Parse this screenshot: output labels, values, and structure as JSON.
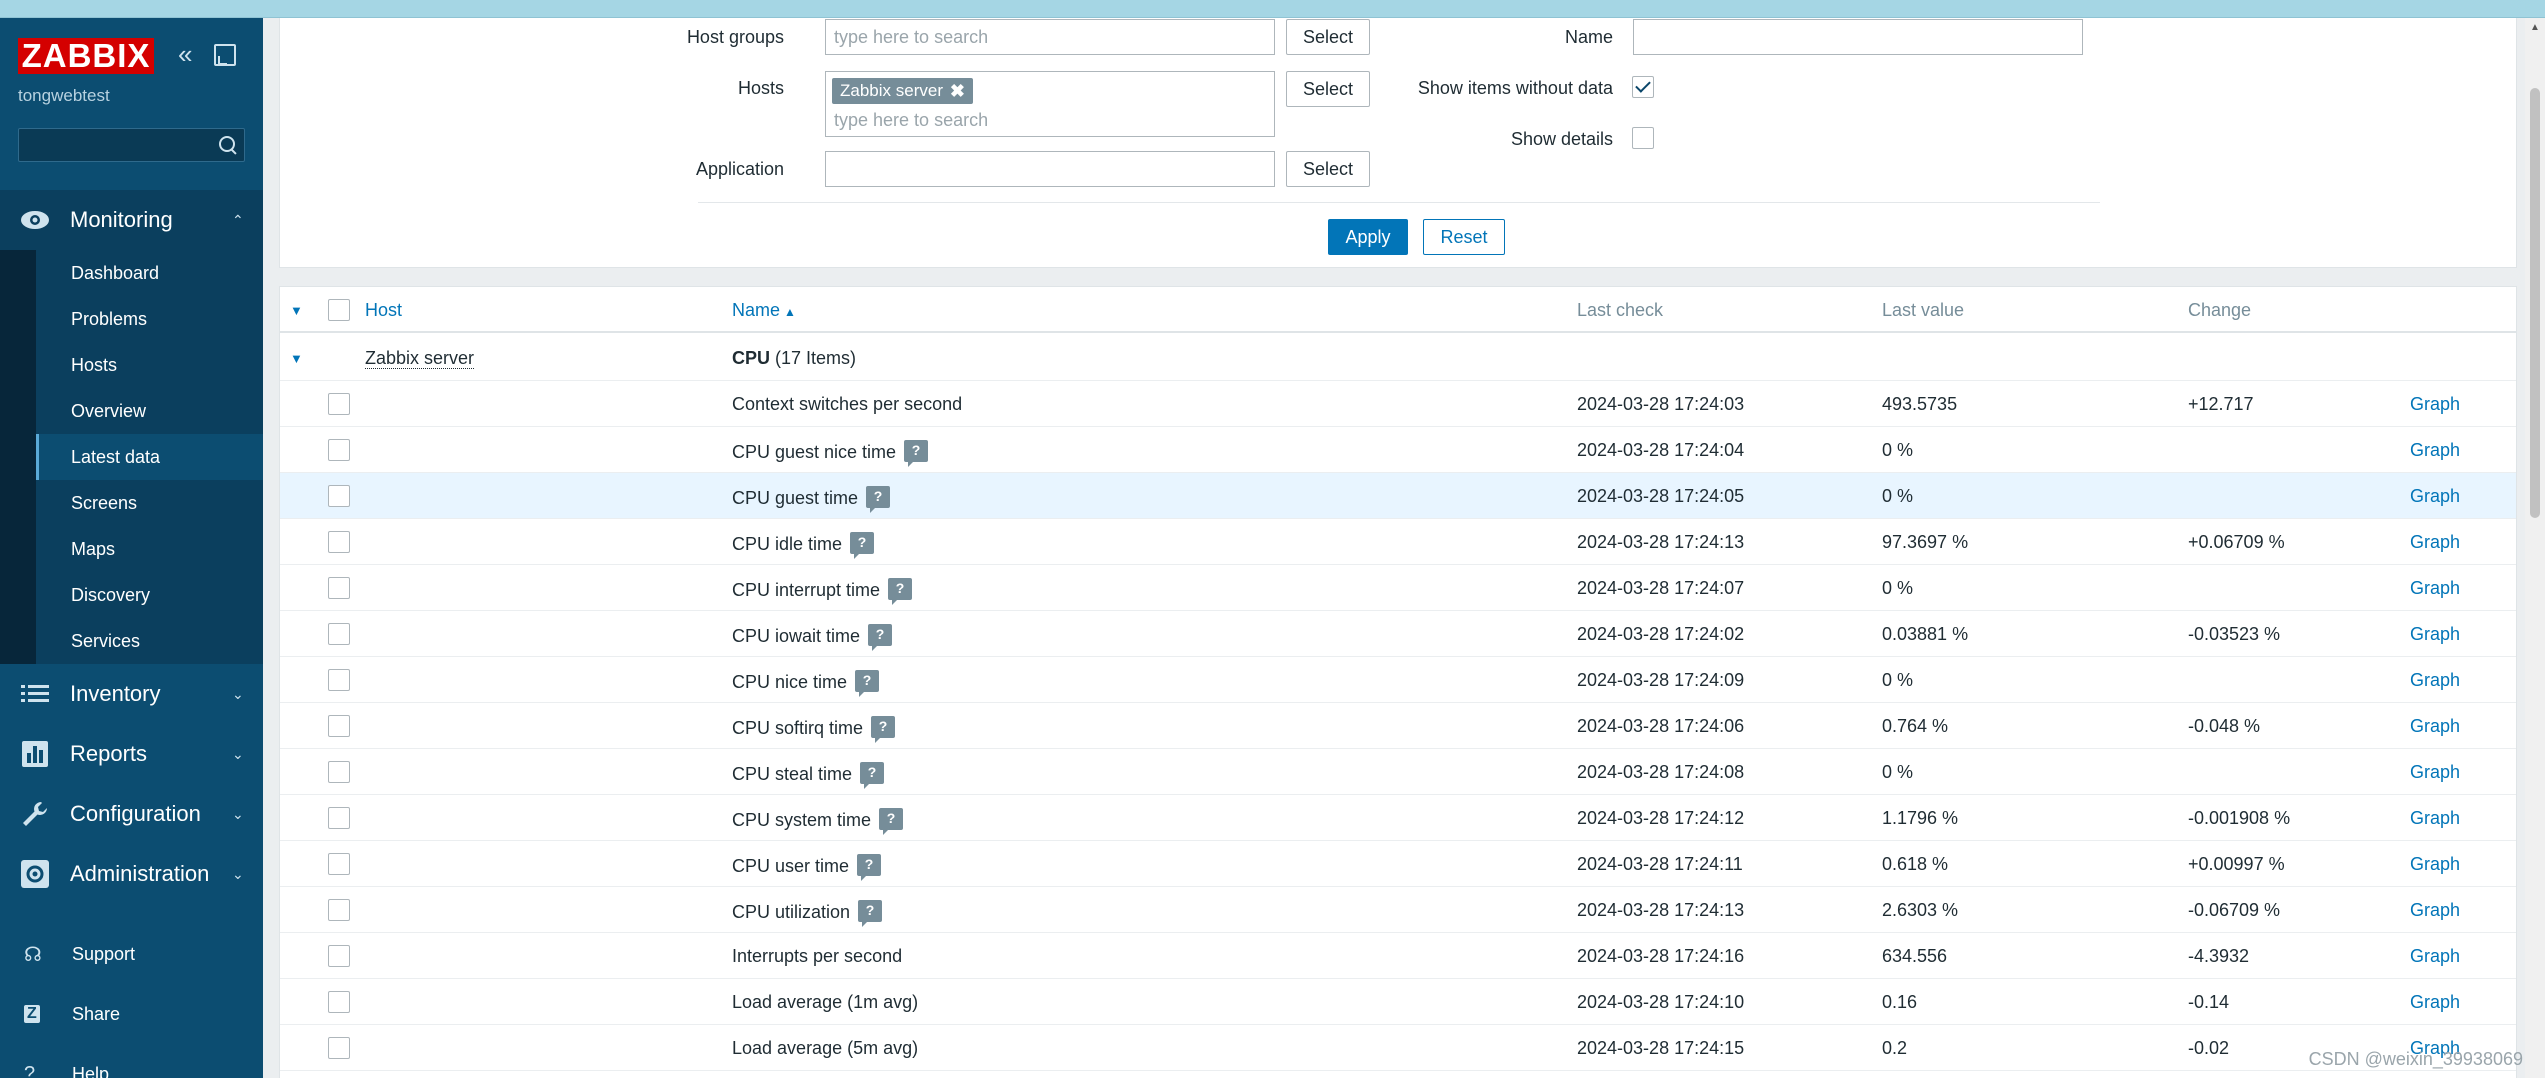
{
  "sidebar": {
    "logo": "ZABBIX",
    "server_name": "tongwebtest",
    "collapse_glyph": "«",
    "sections": [
      {
        "label": "Monitoring",
        "icon": "eye-icon",
        "chevron": "⌃"
      },
      {
        "label": "Inventory",
        "icon": "list-icon",
        "chevron": "⌄"
      },
      {
        "label": "Reports",
        "icon": "bar-chart-icon",
        "chevron": "⌄"
      },
      {
        "label": "Configuration",
        "icon": "wrench-icon",
        "chevron": "⌄"
      },
      {
        "label": "Administration",
        "icon": "gear-icon",
        "chevron": "⌄"
      }
    ],
    "monitoring_items": [
      "Dashboard",
      "Problems",
      "Hosts",
      "Overview",
      "Latest data",
      "Screens",
      "Maps",
      "Discovery",
      "Services"
    ],
    "footer": [
      {
        "label": "Support",
        "icon": "headset-icon",
        "glyph": "☊"
      },
      {
        "label": "Share",
        "icon": "share-icon",
        "glyph": "Z"
      },
      {
        "label": "Help",
        "icon": "help-icon",
        "glyph": "?"
      }
    ]
  },
  "filter": {
    "host_groups_label": "Host groups",
    "host_groups_placeholder": "type here to search",
    "hosts_label": "Hosts",
    "hosts_chip": "Zabbix server",
    "hosts_chip_remove": "✖",
    "hosts_placeholder": "type here to search",
    "application_label": "Application",
    "select_label": "Select",
    "name_label": "Name",
    "show_items_without_data_label": "Show items without data",
    "show_items_without_data": true,
    "show_details_label": "Show details",
    "show_details": false,
    "apply_label": "Apply",
    "reset_label": "Reset"
  },
  "table": {
    "headers": {
      "host": "Host",
      "name": "Name",
      "sort_glyph": "▲",
      "last_check": "Last check",
      "last_value": "Last value",
      "change": "Change"
    },
    "group": {
      "host": "Zabbix server",
      "app_name": "CPU",
      "count": "(17 Items)"
    },
    "rows": [
      {
        "name": "Context switches per second",
        "hint": false,
        "last_check": "2024-03-28 17:24:03",
        "last_value": "493.5735",
        "change": "+12.717",
        "action": "Graph"
      },
      {
        "name": "CPU guest nice time",
        "hint": true,
        "last_check": "2024-03-28 17:24:04",
        "last_value": "0 %",
        "change": "",
        "action": "Graph"
      },
      {
        "name": "CPU guest time",
        "hint": true,
        "last_check": "2024-03-28 17:24:05",
        "last_value": "0 %",
        "change": "",
        "action": "Graph"
      },
      {
        "name": "CPU idle time",
        "hint": true,
        "last_check": "2024-03-28 17:24:13",
        "last_value": "97.3697 %",
        "change": "+0.06709 %",
        "action": "Graph"
      },
      {
        "name": "CPU interrupt time",
        "hint": true,
        "last_check": "2024-03-28 17:24:07",
        "last_value": "0 %",
        "change": "",
        "action": "Graph"
      },
      {
        "name": "CPU iowait time",
        "hint": true,
        "last_check": "2024-03-28 17:24:02",
        "last_value": "0.03881 %",
        "change": "-0.03523 %",
        "action": "Graph"
      },
      {
        "name": "CPU nice time",
        "hint": true,
        "last_check": "2024-03-28 17:24:09",
        "last_value": "0 %",
        "change": "",
        "action": "Graph"
      },
      {
        "name": "CPU softirq time",
        "hint": true,
        "last_check": "2024-03-28 17:24:06",
        "last_value": "0.764 %",
        "change": "-0.048 %",
        "action": "Graph"
      },
      {
        "name": "CPU steal time",
        "hint": true,
        "last_check": "2024-03-28 17:24:08",
        "last_value": "0 %",
        "change": "",
        "action": "Graph"
      },
      {
        "name": "CPU system time",
        "hint": true,
        "last_check": "2024-03-28 17:24:12",
        "last_value": "1.1796 %",
        "change": "-0.001908 %",
        "action": "Graph"
      },
      {
        "name": "CPU user time",
        "hint": true,
        "last_check": "2024-03-28 17:24:11",
        "last_value": "0.618 %",
        "change": "+0.00997 %",
        "action": "Graph"
      },
      {
        "name": "CPU utilization",
        "hint": true,
        "last_check": "2024-03-28 17:24:13",
        "last_value": "2.6303 %",
        "change": "-0.06709 %",
        "action": "Graph"
      },
      {
        "name": "Interrupts per second",
        "hint": false,
        "last_check": "2024-03-28 17:24:16",
        "last_value": "634.556",
        "change": "-4.3932",
        "action": "Graph"
      },
      {
        "name": "Load average (1m avg)",
        "hint": false,
        "last_check": "2024-03-28 17:24:10",
        "last_value": "0.16",
        "change": "-0.14",
        "action": "Graph"
      },
      {
        "name": "Load average (5m avg)",
        "hint": false,
        "last_check": "2024-03-28 17:24:15",
        "last_value": "0.2",
        "change": "-0.02",
        "action": "Graph"
      }
    ]
  },
  "watermark": "CSDN @weixin_39938069",
  "colors": {
    "sidebar_bg": "#0c4d71",
    "logo_bg": "#d40000",
    "link": "#0275b8",
    "apply_bg": "#0275b8",
    "chip_bg": "#768d99",
    "row_highlight": "#e8f5ff"
  }
}
